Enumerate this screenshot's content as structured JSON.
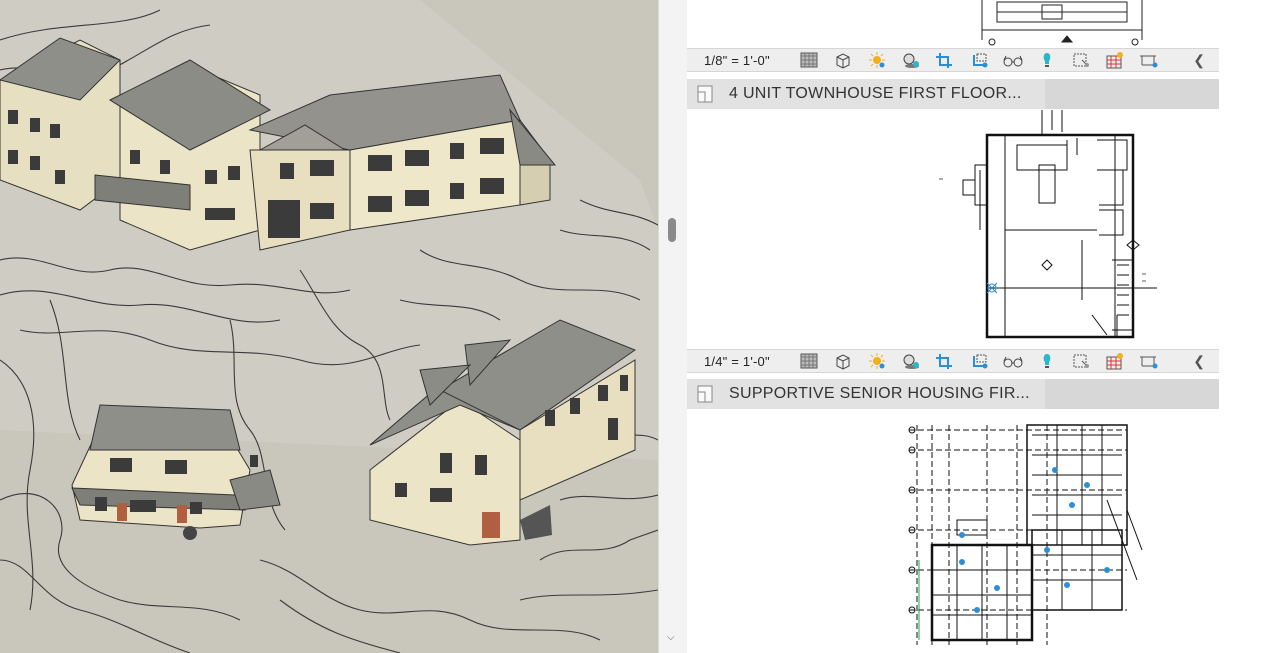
{
  "viewports": [
    {
      "scale_label": "1/8\" = 1'-0\"",
      "title": ""
    },
    {
      "scale_label": "1/4\" = 1'-0\"",
      "title": "4 UNIT TOWNHOUSE FIRST FLOOR..."
    },
    {
      "scale_label": "",
      "title": "SUPPORTIVE SENIOR HOUSING FIR..."
    }
  ],
  "view_control_icons": [
    "detail-level-icon",
    "visual-style-cube-icon",
    "sun-path-icon",
    "shadows-icon",
    "crop-view-icon",
    "show-crop-region-icon",
    "temporary-hide-glasses-icon",
    "reveal-hidden-icon",
    "temporary-view-properties-icon",
    "analysis-display-icon",
    "highlight-displacement-icon"
  ],
  "colors": {
    "terrain": "#c9c7bc",
    "siding": "#ece4c6",
    "roof": "#8f8f8a",
    "trim": "#6e6e6e",
    "door": "#b06040",
    "toolbar_bg": "#eeeeee",
    "title_bg": "#e2e2e2",
    "accent_blue": "#2c8fd6"
  }
}
